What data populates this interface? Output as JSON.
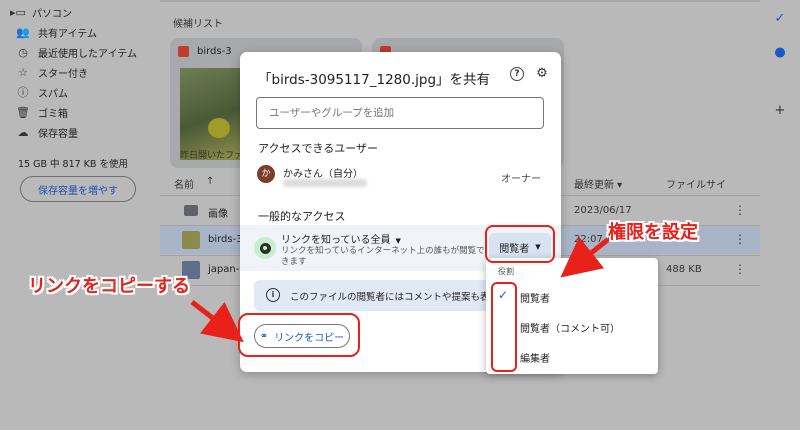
{
  "sidebar": {
    "items": [
      {
        "label": "パソコン",
        "icon": "computer-icon"
      },
      {
        "label": "共有アイテム",
        "icon": "shared-icon"
      },
      {
        "label": "最近使用したアイテム",
        "icon": "recent-icon"
      },
      {
        "label": "スター付き",
        "icon": "star-icon"
      },
      {
        "label": "スパム",
        "icon": "spam-icon"
      },
      {
        "label": "ゴミ箱",
        "icon": "trash-icon"
      },
      {
        "label": "保存容量",
        "icon": "cloud-icon"
      }
    ],
    "storage_text": "15 GB 中 817 KB を使用",
    "storage_button": "保存容量を増やす"
  },
  "main": {
    "suggested_title": "候補リスト",
    "cards": [
      {
        "name": "birds-3",
        "footer": "昨日開いたファ"
      },
      {
        "name": "",
        "footer": ""
      }
    ],
    "columns": {
      "name": "名前",
      "sort_arrow": "↑",
      "modified": "最終更新 ▾",
      "size": "ファイルサイ"
    },
    "rows": [
      {
        "name": "画像",
        "date": "2023/06/17",
        "size": "",
        "type": "folder"
      },
      {
        "name": "birds-3",
        "date": "22:07",
        "size": "",
        "type": "image"
      },
      {
        "name": "japan-3",
        "date": "",
        "size": "488 KB",
        "type": "image"
      }
    ]
  },
  "dialog": {
    "title": "「birds-3095117_1280.jpg」を共有",
    "add_placeholder": "ユーザーやグループを追加",
    "access_label": "アクセスできるユーザー",
    "user": {
      "avatar_letter": "か",
      "name": "かみさん（自分）",
      "role": "オーナー"
    },
    "general_label": "一般的なアクセス",
    "link_mode": "リンクを知っている全員",
    "link_desc": "リンクを知っているインターネット上の誰もが閲覧できます",
    "role_button": "閲覧者",
    "info_text": "このファイルの閲覧者にはコメントや提案も表示さ",
    "copy_link": "リンクをコピー"
  },
  "role_menu": {
    "caption": "役割",
    "items": [
      {
        "label": "閲覧者",
        "checked": true
      },
      {
        "label": "閲覧者（コメント可）",
        "checked": false
      },
      {
        "label": "編集者",
        "checked": false
      }
    ]
  },
  "annotations": {
    "set_permission": "権限を設定",
    "copy_link_note": "リンクをコピーする",
    "accent_color": "#e8221b"
  }
}
